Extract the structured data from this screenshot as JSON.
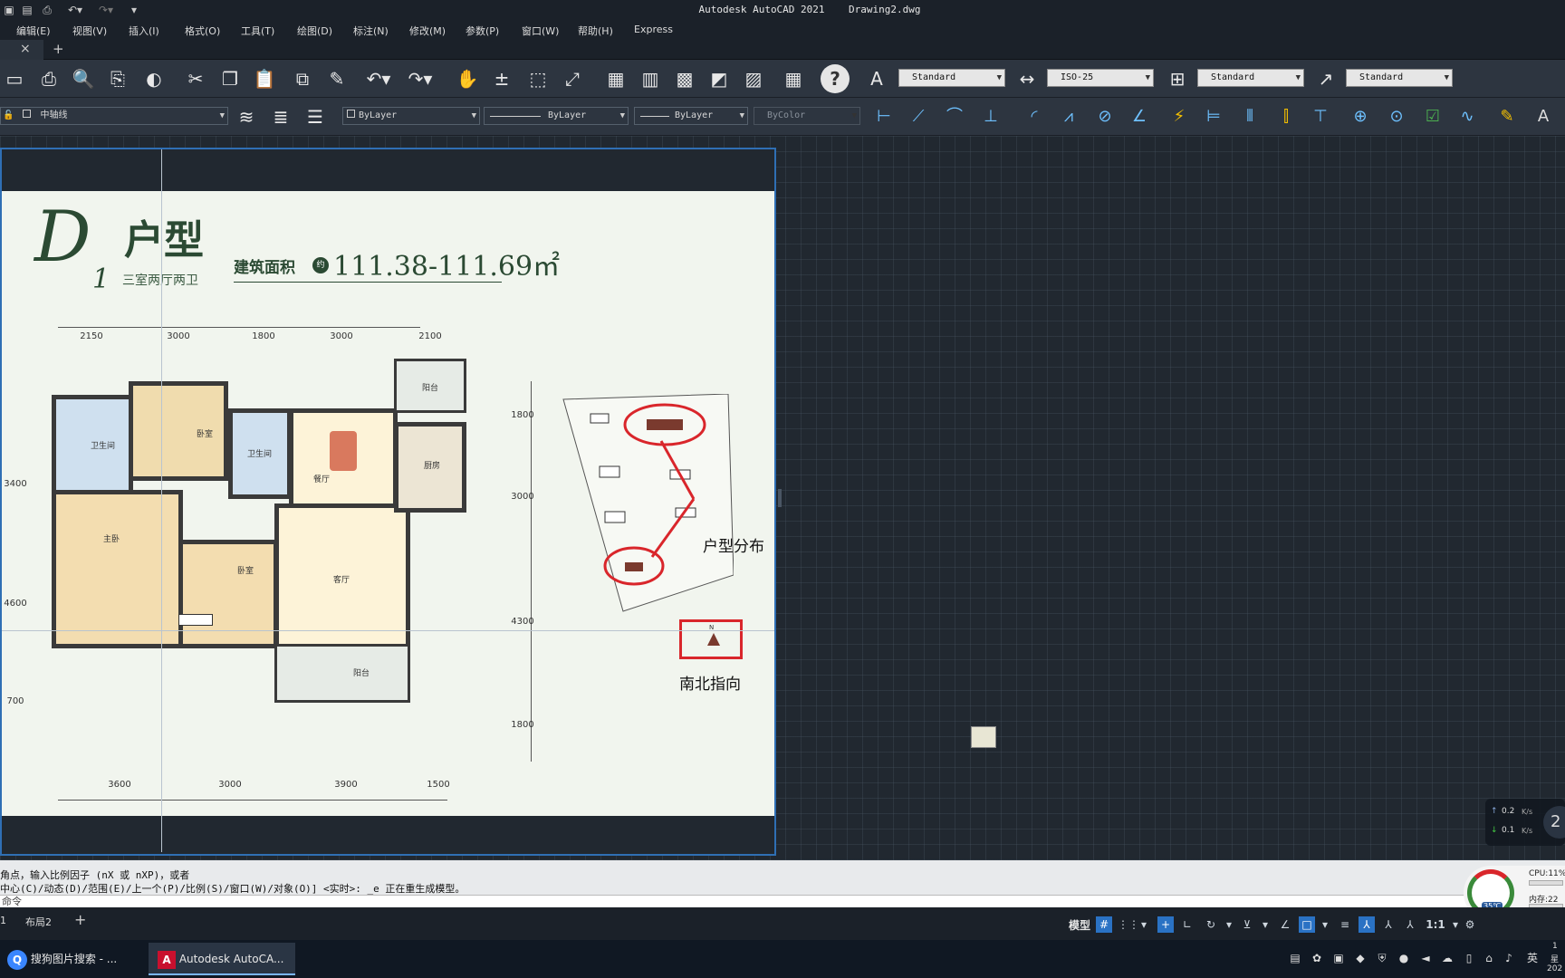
{
  "window": {
    "title": "Autodesk AutoCAD 2021",
    "file": "Drawing2.dwg"
  },
  "menu": [
    "编辑(E)",
    "视图(V)",
    "插入(I)",
    "格式(O)",
    "工具(T)",
    "绘图(D)",
    "标注(N)",
    "修改(M)",
    "参数(P)",
    "窗口(W)",
    "帮助(H)",
    "Express"
  ],
  "styles": {
    "text_style": "Standard",
    "dim_style": "ISO-25",
    "table_style": "Standard",
    "mleader_style": "Standard"
  },
  "layers": {
    "current": "中轴线",
    "color": "ByLayer",
    "linetype": "ByLayer",
    "lineweight": "ByLayer",
    "plotstyle": "ByColor"
  },
  "drawing": {
    "unit_code": "D",
    "unit_sub": "1",
    "unit_type": "户型",
    "rooms_desc": "三室两厅两卫",
    "area_label": "建筑面积",
    "area_badge": "约",
    "area_value": "111.38-111.69㎡",
    "dims_top": [
      "2150",
      "3000",
      "1800",
      "3000",
      "2100"
    ],
    "dims_bottom": [
      "3600",
      "3000",
      "3900",
      "1500"
    ],
    "dims_left": [
      "3400",
      "4600",
      "700"
    ],
    "dims_right": [
      "1800",
      "3000",
      "4300",
      "1800"
    ],
    "room_labels": {
      "bath1": "卫生间",
      "bath2": "卫生间",
      "bed1": "卧室",
      "master": "主卧",
      "bed2": "卧室",
      "dining": "餐厅",
      "living": "客厅",
      "kitchen": "厨房",
      "balcony1": "阳台",
      "balcony2": "阳台"
    },
    "annotation_layout": "户型分布",
    "annotation_north": "南北指向",
    "north_letter": "N"
  },
  "command": {
    "line1": "角点，输入比例因子 (nX 或 nXP)，或者",
    "line2": "中心(C)/动态(D)/范围(E)/上一个(P)/比例(S)/窗口(W)/对象(O)] <实时>: _e 正在重生成模型。",
    "prompt": "命令"
  },
  "layout_tabs": [
    "1",
    "布局2"
  ],
  "status": {
    "model": "模型",
    "scale": "1:1"
  },
  "netmon": {
    "up": "0.2",
    "down": "0.1",
    "unit": "K/s",
    "big": "2"
  },
  "sysmon": {
    "cpu": "CPU:11%",
    "mem": "内存:22",
    "temp": "35℃"
  },
  "taskbar": [
    {
      "label": "搜狗图片搜索 - ..."
    },
    {
      "label": "Autodesk AutoCA..."
    }
  ],
  "tray": {
    "ime": "英",
    "clock_top": "1",
    "clock_mid": "星",
    "clock_bot": "202"
  }
}
